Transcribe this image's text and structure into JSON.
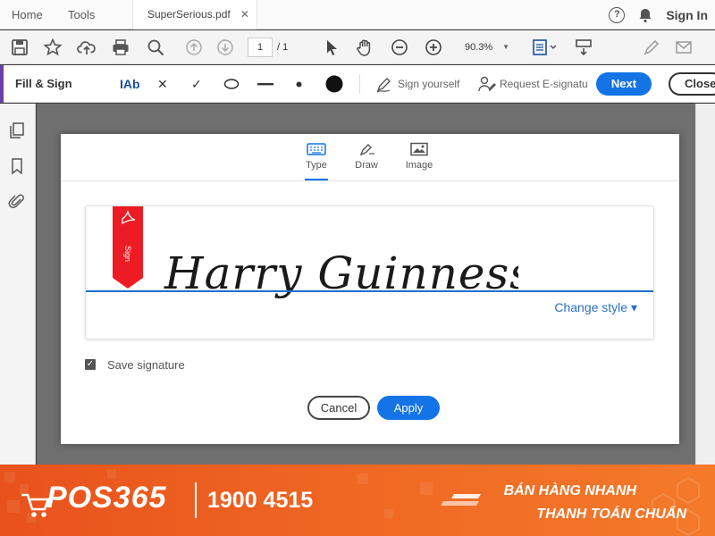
{
  "tabs": {
    "home": "Home",
    "tools": "Tools",
    "document": "SuperSerious.pdf",
    "close_glyph": "✕",
    "help_glyph": "?",
    "sign_in": "Sign In"
  },
  "toolbar": {
    "page_current": "1",
    "page_total": "/ 1",
    "zoom": "90.3%",
    "zoom_caret": "▼",
    "icons": [
      "save-icon",
      "star-icon",
      "upload-icon",
      "print-icon",
      "search-icon",
      "prev-page-icon",
      "next-page-icon",
      "pointer-icon",
      "hand-icon",
      "zoom-out-icon",
      "zoom-in-icon",
      "fit-page-icon",
      "scroll-mode-icon",
      "edit-icon",
      "mail-icon"
    ]
  },
  "fill_sign": {
    "title": "Fill & Sign",
    "text_tool": "IAb",
    "cross_tool": "✕",
    "check_tool": "✓",
    "sign_yourself": "Sign yourself",
    "request_esign": "Request E-signatu",
    "next": "Next",
    "close": "Close",
    "accent_color": "#6d3ea6"
  },
  "dialog": {
    "tabs": [
      {
        "label": "Type",
        "icon": "keyboard-icon",
        "active": true
      },
      {
        "label": "Draw",
        "icon": "pen-icon",
        "active": false
      },
      {
        "label": "Image",
        "icon": "image-icon",
        "active": false
      }
    ],
    "ribbon_label": "Sign",
    "signature_text": "Harry Guinness",
    "change_style": "Change style ▾",
    "save_checked_glyph": "✓",
    "save_signature": "Save signature",
    "cancel": "Cancel",
    "apply": "Apply",
    "primary_color": "#1473e6"
  },
  "banner": {
    "brand": "POS365",
    "phone": "1900 4515",
    "slogan_line1": "BÁN HÀNG NHANH",
    "slogan_line2": "THANH TOÁN CHUẨN",
    "background": "#ef6322"
  }
}
